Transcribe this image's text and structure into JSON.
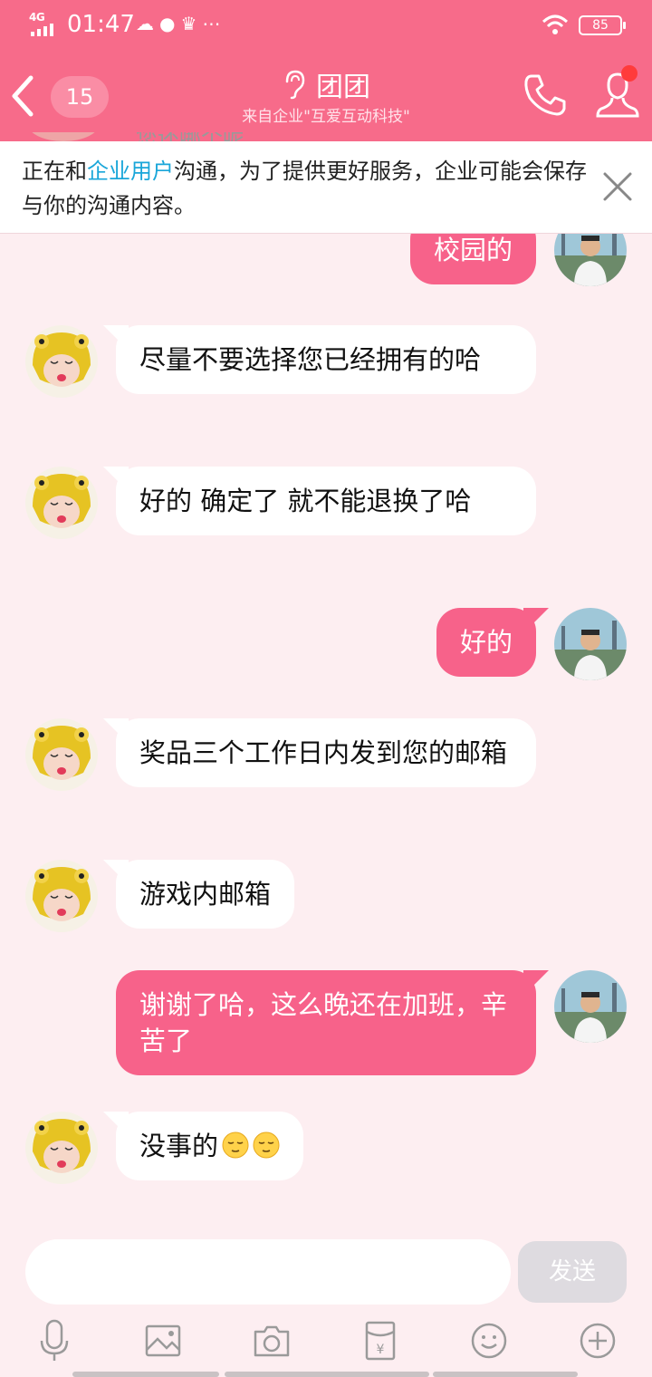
{
  "status_bar": {
    "network": "4G",
    "time": "01:47",
    "battery": "85"
  },
  "header": {
    "unread_count": "15",
    "title": "团团",
    "subtitle": "来自企业\"互爱互动科技\""
  },
  "notice": {
    "text_before": "正在和",
    "link": "企业用户",
    "text_after": "沟通，为了提供更好服务，企业可能会保存与你的沟通内容。",
    "faded_previous": "您还哪个呢"
  },
  "messages": [
    {
      "side": "out",
      "text": "校园的"
    },
    {
      "side": "in",
      "text": "尽量不要选择您已经拥有的哈"
    },
    {
      "side": "in",
      "text": "好的 确定了 就不能退换了哈"
    },
    {
      "side": "out",
      "text": "好的"
    },
    {
      "side": "in",
      "text": "奖品三个工作日内发到您的邮箱"
    },
    {
      "side": "in",
      "text": "游戏内邮箱"
    },
    {
      "side": "out",
      "text": "谢谢了哈，这么晚还在加班，辛苦了"
    },
    {
      "side": "in",
      "text": "没事的",
      "emoji": [
        "relieved-face-icon",
        "relieved-face-icon"
      ]
    }
  ],
  "input": {
    "placeholder": "",
    "send_label": "发送"
  },
  "toolbar": [
    "microphone-icon",
    "image-icon",
    "camera-icon",
    "red-packet-icon",
    "emoji-icon",
    "plus-icon"
  ],
  "colors": {
    "brand": "#f76b8a",
    "outgoing_bubble": "#f7628a",
    "background": "#fdeef1",
    "link": "#19a6d9"
  }
}
